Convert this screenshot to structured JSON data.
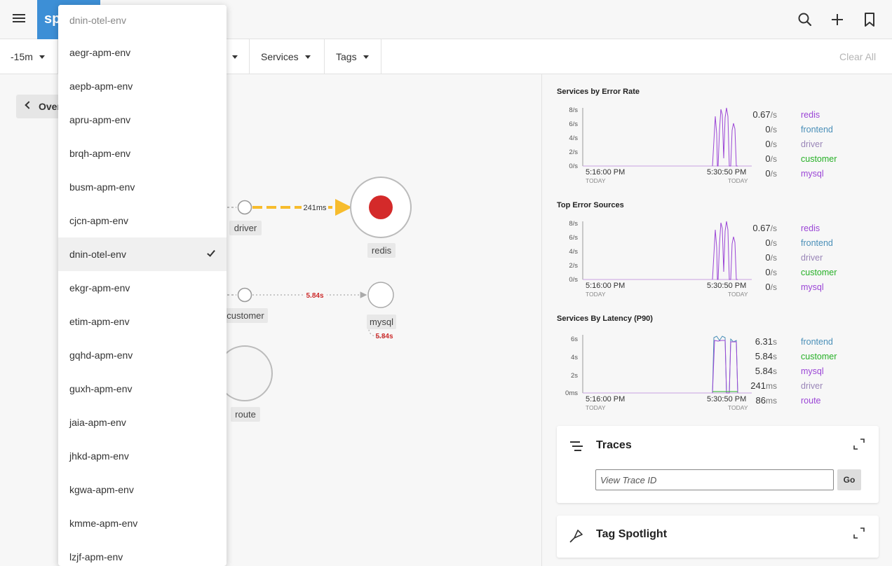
{
  "header": {
    "logo_text": "sp",
    "logo_color": "#3d8fd6",
    "icons": [
      "menu-icon",
      "search-icon",
      "plus-icon",
      "bookmark-icon"
    ]
  },
  "filters": {
    "time": "-15m",
    "services": "Services",
    "tags": "Tags",
    "clear_all": "Clear All"
  },
  "overview_label": "Overview",
  "env_dropdown": {
    "search_value": "dnin-otel-env",
    "items": [
      {
        "label": "aegr-apm-env"
      },
      {
        "label": "aepb-apm-env"
      },
      {
        "label": "apru-apm-env"
      },
      {
        "label": "brqh-apm-env"
      },
      {
        "label": "busm-apm-env"
      },
      {
        "label": "cjcn-apm-env"
      },
      {
        "label": "dnin-otel-env",
        "selected": true
      },
      {
        "label": "ekgr-apm-env"
      },
      {
        "label": "etim-apm-env"
      },
      {
        "label": "gqhd-apm-env"
      },
      {
        "label": "guxh-apm-env"
      },
      {
        "label": "jaia-apm-env"
      },
      {
        "label": "jhkd-apm-env"
      },
      {
        "label": "kgwa-apm-env"
      },
      {
        "label": "kmme-apm-env"
      },
      {
        "label": "lzjf-apm-env"
      }
    ]
  },
  "service_map": {
    "nodes": {
      "driver": "driver",
      "redis": "redis",
      "customer": "customer",
      "mysql": "mysql",
      "route": "route"
    },
    "edges": {
      "driver_redis_latency": "241ms",
      "customer_mysql_latency": "5.84s",
      "mysql_self_latency": "5.84s"
    },
    "colors": {
      "error": "#d42a2a",
      "edge_highlight": "#f7bc2d"
    }
  },
  "charts": {
    "error_rate": {
      "title": "Services by Error Rate",
      "y_ticks": [
        "8/s",
        "6/s",
        "4/s",
        "2/s",
        "0/s"
      ],
      "x_ticks": [
        {
          "time": "5:16:00 PM",
          "day": "TODAY"
        },
        {
          "time": "5:30:50 PM",
          "day": "TODAY"
        }
      ],
      "legend": [
        {
          "value": "0.67",
          "unit": "/s",
          "name": "redis",
          "color": "#9b46d6"
        },
        {
          "value": "0",
          "unit": "/s",
          "name": "frontend",
          "color": "#4a8fb8"
        },
        {
          "value": "0",
          "unit": "/s",
          "name": "driver",
          "color": "#9a86b8"
        },
        {
          "value": "0",
          "unit": "/s",
          "name": "customer",
          "color": "#27b027"
        },
        {
          "value": "0",
          "unit": "/s",
          "name": "mysql",
          "color": "#9b46d6"
        }
      ]
    },
    "error_sources": {
      "title": "Top Error Sources",
      "y_ticks": [
        "8/s",
        "6/s",
        "4/s",
        "2/s",
        "0/s"
      ],
      "x_ticks": [
        {
          "time": "5:16:00 PM",
          "day": "TODAY"
        },
        {
          "time": "5:30:50 PM",
          "day": "TODAY"
        }
      ],
      "legend": [
        {
          "value": "0.67",
          "unit": "/s",
          "name": "redis",
          "color": "#9b46d6"
        },
        {
          "value": "0",
          "unit": "/s",
          "name": "frontend",
          "color": "#4a8fb8"
        },
        {
          "value": "0",
          "unit": "/s",
          "name": "driver",
          "color": "#9a86b8"
        },
        {
          "value": "0",
          "unit": "/s",
          "name": "customer",
          "color": "#27b027"
        },
        {
          "value": "0",
          "unit": "/s",
          "name": "mysql",
          "color": "#9b46d6"
        }
      ]
    },
    "latency": {
      "title": "Services By Latency (P90)",
      "y_ticks": [
        "6s",
        "4s",
        "2s",
        "0ms"
      ],
      "x_ticks": [
        {
          "time": "5:16:00 PM",
          "day": "TODAY"
        },
        {
          "time": "5:30:50 PM",
          "day": "TODAY"
        }
      ],
      "legend": [
        {
          "value": "6.31",
          "unit": "s",
          "name": "frontend",
          "color": "#4a8fb8"
        },
        {
          "value": "5.84",
          "unit": "s",
          "name": "customer",
          "color": "#27b027"
        },
        {
          "value": "5.84",
          "unit": "s",
          "name": "mysql",
          "color": "#9b46d6"
        },
        {
          "value": "241",
          "unit": "ms",
          "name": "driver",
          "color": "#9a86b8"
        },
        {
          "value": "86",
          "unit": "ms",
          "name": "route",
          "color": "#9b46d6"
        }
      ]
    }
  },
  "traces": {
    "title": "Traces",
    "input_placeholder": "View Trace ID",
    "go_label": "Go"
  },
  "tag_spotlight": {
    "title": "Tag Spotlight"
  }
}
